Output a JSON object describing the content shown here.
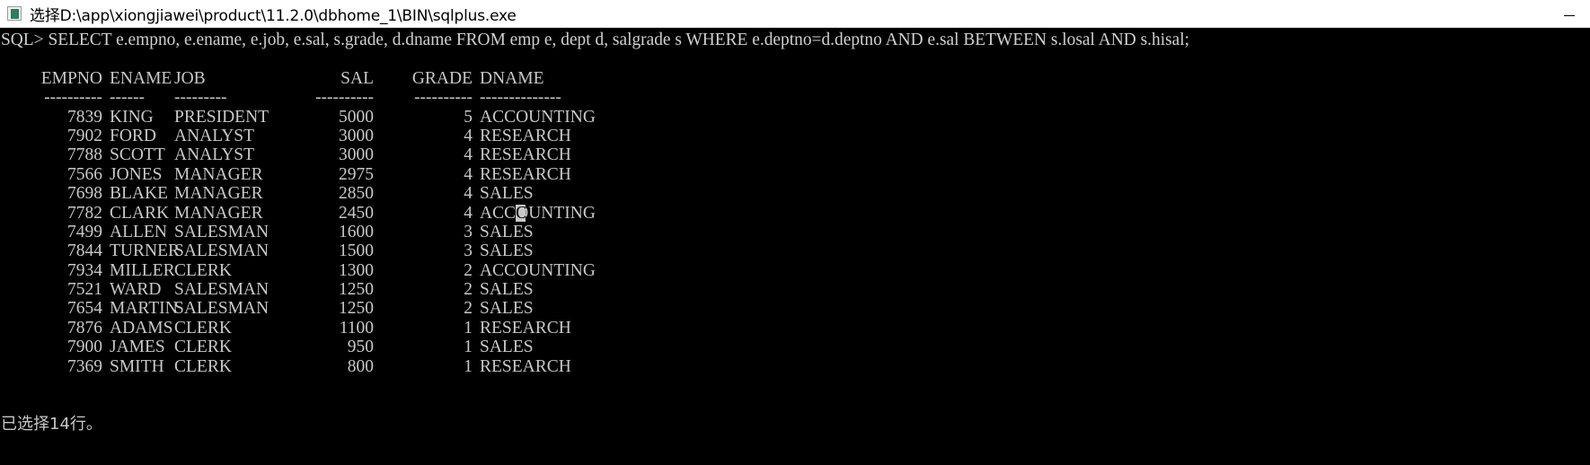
{
  "window": {
    "title": "选择D:\\app\\xiongjiawei\\product\\11.2.0\\dbhome_1\\BIN\\sqlplus.exe",
    "icon_name": "console-app-icon",
    "minimize_label": "",
    "background_color": "#000000",
    "text_color": "#c8c8c8",
    "titlebar_color": "#ffffff"
  },
  "terminal": {
    "prompt": "SQL>",
    "command": "SELECT e.empno, e.ename, e.job, e.sal, s.grade, d.dname FROM emp e, dept d, salgrade s WHERE e.deptno=d.deptno AND e.sal BETWEEN s.losal AND s.hisal;",
    "command_full_line": "SQL> SELECT e.empno, e.ename, e.job, e.sal, s.grade, d.dname FROM emp e, dept d, salgrade s WHERE e.deptno=d.deptno AND e.sal BETWEEN s.losal AND s.hisal;",
    "headers": {
      "empno": "EMPNO",
      "ename": "ENAME",
      "job": "JOB",
      "sal": "SAL",
      "grade": "GRADE",
      "dname": "DNAME"
    },
    "separator": {
      "empno": "----------",
      "ename": "------",
      "job": "---------",
      "sal": "----------",
      "grade": "----------",
      "dname": "--------------"
    },
    "rows": [
      {
        "empno": "7839",
        "ename": "KING",
        "job": "PRESIDENT",
        "sal": "5000",
        "grade": "5",
        "dname": "ACCOUNTING"
      },
      {
        "empno": "7902",
        "ename": "FORD",
        "job": "ANALYST",
        "sal": "3000",
        "grade": "4",
        "dname": "RESEARCH"
      },
      {
        "empno": "7788",
        "ename": "SCOTT",
        "job": "ANALYST",
        "sal": "3000",
        "grade": "4",
        "dname": "RESEARCH"
      },
      {
        "empno": "7566",
        "ename": "JONES",
        "job": "MANAGER",
        "sal": "2975",
        "grade": "4",
        "dname": "RESEARCH"
      },
      {
        "empno": "7698",
        "ename": "BLAKE",
        "job": "MANAGER",
        "sal": "2850",
        "grade": "4",
        "dname": "SALES"
      },
      {
        "empno": "7782",
        "ename": "CLARK",
        "job": "MANAGER",
        "sal": "2450",
        "grade": "4",
        "dname": "ACCOUNTING"
      },
      {
        "empno": "7499",
        "ename": "ALLEN",
        "job": "SALESMAN",
        "sal": "1600",
        "grade": "3",
        "dname": "SALES"
      },
      {
        "empno": "7844",
        "ename": "TURNER",
        "job": "SALESMAN",
        "sal": "1500",
        "grade": "3",
        "dname": "SALES"
      },
      {
        "empno": "7934",
        "ename": "MILLER",
        "job": "CLERK",
        "sal": "1300",
        "grade": "2",
        "dname": "ACCOUNTING"
      },
      {
        "empno": "7521",
        "ename": "WARD",
        "job": "SALESMAN",
        "sal": "1250",
        "grade": "2",
        "dname": "SALES"
      },
      {
        "empno": "7654",
        "ename": "MARTIN",
        "job": "SALESMAN",
        "sal": "1250",
        "grade": "2",
        "dname": "SALES"
      },
      {
        "empno": "7876",
        "ename": "ADAMS",
        "job": "CLERK",
        "sal": "1100",
        "grade": "1",
        "dname": "RESEARCH"
      },
      {
        "empno": "7900",
        "ename": "JAMES",
        "job": "CLERK",
        "sal": "950",
        "grade": "1",
        "dname": "SALES"
      },
      {
        "empno": "7369",
        "ename": "SMITH",
        "job": "CLERK",
        "sal": "800",
        "grade": "1",
        "dname": "RESEARCH"
      }
    ],
    "cursor": {
      "row_index": 5,
      "column": "dname",
      "char_index": 3,
      "note": "block caret over the 'O' of ACCOUNTING"
    },
    "status_line": "已选择14行。",
    "row_count": 14
  }
}
